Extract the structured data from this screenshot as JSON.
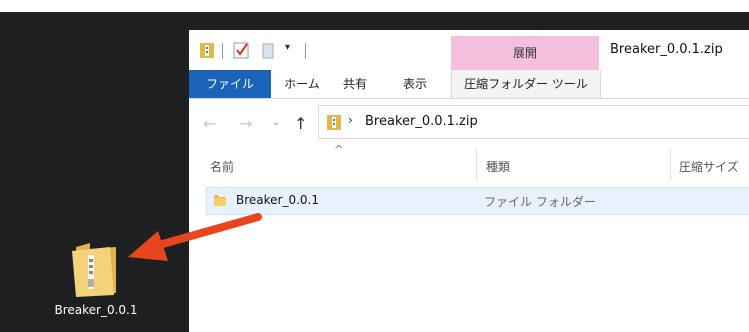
{
  "desktop": {
    "icon_label": "Breaker_0.0.1"
  },
  "window": {
    "title": "Breaker_0.0.1.zip",
    "context_tab": "展開",
    "tabs": [
      "ファイル",
      "ホーム",
      "共有",
      "表示",
      "圧縮フォルダー ツール"
    ],
    "address": "Breaker_0.0.1.zip",
    "columns": [
      "名前",
      "種類",
      "圧縮サイズ"
    ],
    "rows": [
      {
        "name": "Breaker_0.0.1",
        "type": "ファイル フォルダー"
      }
    ]
  },
  "colors": {
    "file_tab": "#1a63b9",
    "context_tab": "#f5c0dd",
    "arrow": "#e8451f",
    "desktop": "#1e1f20"
  }
}
